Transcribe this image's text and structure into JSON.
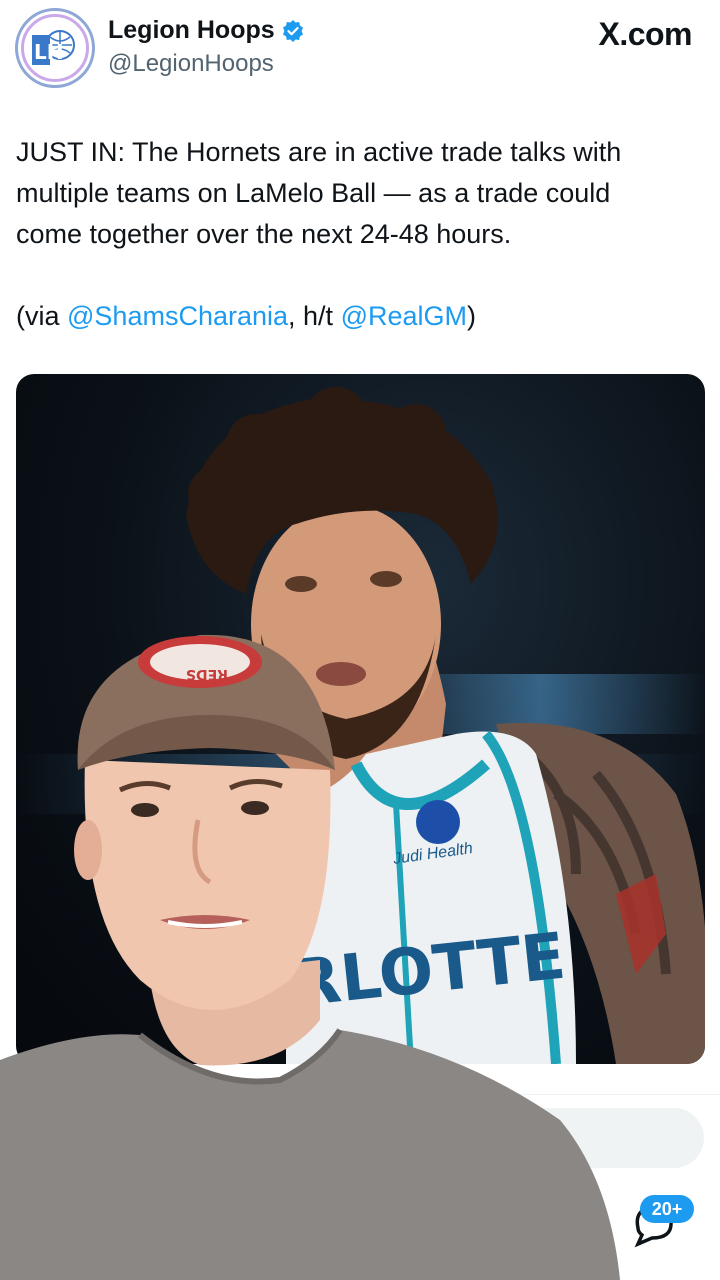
{
  "tweet": {
    "author": {
      "display_name": "Legion Hoops",
      "handle": "@LegionHoops",
      "verified": true,
      "avatar_text": "LH"
    },
    "source_label": "X.com",
    "text_lines": [
      "JUST IN: The Hornets are in active trade talks with",
      "multiple teams on LaMelo Ball — as a trade could",
      "come together over the next 24-48 hours."
    ],
    "via": {
      "prefix": "(via ",
      "mention_1": "@ShamsCharania",
      "middle": ", h/t ",
      "mention_2": "@RealGM",
      "suffix": ")"
    },
    "media": {
      "jersey_text": "RLOTTE",
      "sponsor_text": "Judi Health"
    },
    "reply_count_badge": "20+"
  },
  "overlay": {
    "cap_patch_text": "REDS"
  },
  "colors": {
    "link": "#1d9bf0",
    "verified": "#1d9bf0",
    "text": "#0f1419",
    "secondary": "#536471"
  }
}
